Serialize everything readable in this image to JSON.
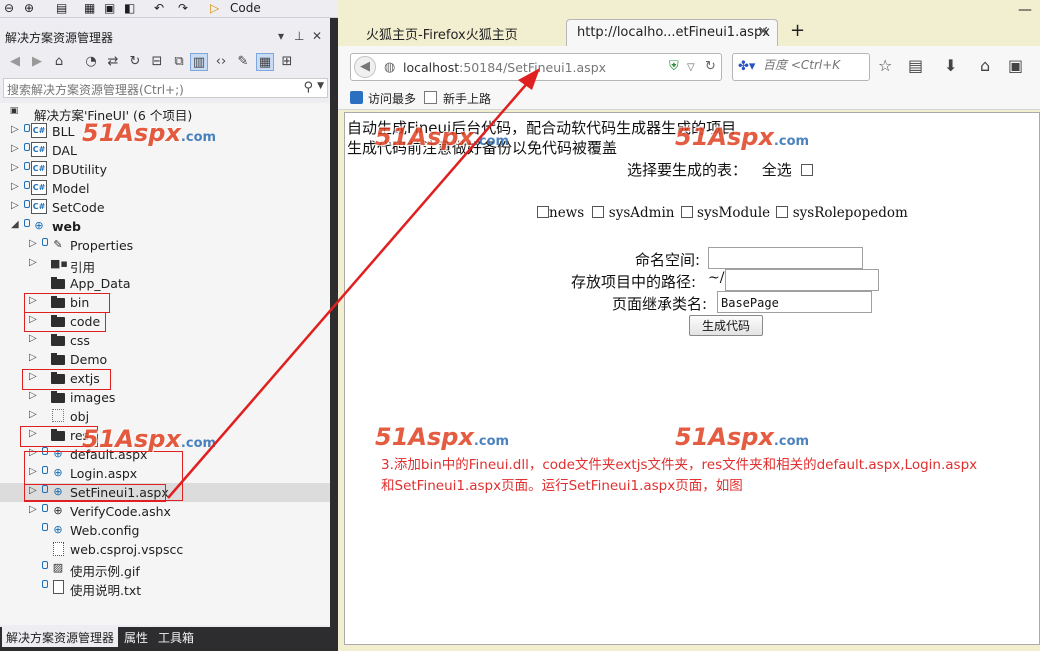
{
  "vs": {
    "top_label": "Code",
    "panel_title": "解决方案资源管理器",
    "panel_controls": [
      "▾",
      "📌",
      "✕"
    ],
    "search_placeholder": "搜索解决方案资源管理器(Ctrl+;)",
    "tree": [
      {
        "label": "解决方案'FineUI' (6 个项目)",
        "level": 0,
        "icon": "solution-icon"
      },
      {
        "label": "BLL",
        "level": 1,
        "icon": "csharp-project-icon"
      },
      {
        "label": "DAL",
        "level": 1,
        "icon": "csharp-project-icon"
      },
      {
        "label": "DBUtility",
        "level": 1,
        "icon": "csharp-project-icon"
      },
      {
        "label": "Model",
        "level": 1,
        "icon": "csharp-project-icon"
      },
      {
        "label": "SetCode",
        "level": 1,
        "icon": "csharp-project-icon"
      },
      {
        "label": "web",
        "level": 1,
        "icon": "web-project-icon",
        "expanded": true
      },
      {
        "label": "Properties",
        "level": 2,
        "icon": "wrench-icon"
      },
      {
        "label": "引用",
        "level": 2,
        "icon": "references-icon"
      },
      {
        "label": "App_Data",
        "level": 2,
        "icon": "folder-icon"
      },
      {
        "label": "bin",
        "level": 2,
        "icon": "folder-icon"
      },
      {
        "label": "code",
        "level": 2,
        "icon": "folder-icon"
      },
      {
        "label": "css",
        "level": 2,
        "icon": "folder-icon"
      },
      {
        "label": "Demo",
        "level": 2,
        "icon": "folder-icon"
      },
      {
        "label": "extjs",
        "level": 2,
        "icon": "folder-icon"
      },
      {
        "label": "images",
        "level": 2,
        "icon": "folder-icon"
      },
      {
        "label": "obj",
        "level": 2,
        "icon": "hidden-folder-icon"
      },
      {
        "label": "res",
        "level": 2,
        "icon": "folder-icon"
      },
      {
        "label": "default.aspx",
        "level": 2,
        "icon": "web-file-icon"
      },
      {
        "label": "Login.aspx",
        "level": 2,
        "icon": "web-file-icon"
      },
      {
        "label": "SetFineui1.aspx",
        "level": 2,
        "icon": "web-file-icon"
      },
      {
        "label": "VerifyCode.ashx",
        "level": 2,
        "icon": "web-handler-icon"
      },
      {
        "label": "Web.config",
        "level": 2,
        "icon": "config-icon"
      },
      {
        "label": "web.csproj.vspscc",
        "level": 2,
        "icon": "file-icon"
      },
      {
        "label": "使用示例.gif",
        "level": 2,
        "icon": "image-file-icon"
      },
      {
        "label": "使用说明.txt",
        "level": 2,
        "icon": "text-file-icon"
      }
    ],
    "bottom_tabs": [
      "解决方案资源管理器",
      "属性",
      "工具箱"
    ]
  },
  "browser": {
    "tabs": [
      {
        "label": "火狐主页-Firefox火狐主页",
        "active": false
      },
      {
        "label": "http://localho...etFineui1.aspx",
        "active": true
      }
    ],
    "new_tab": "+",
    "url_host": "localhost",
    "url_rest": ":50184/SetFineui1.aspx",
    "search_placeholder": "百度 <Ctrl+K",
    "bookmarks": [
      "访问最多",
      "新手上路"
    ]
  },
  "page": {
    "line1": "自动生成Fineui后台代码，配合动软代码生成器生成的项目",
    "line2": "生成代码前注意做好备份以免代码被覆盖",
    "select_label": "选择要生成的表：",
    "select_all": "全选",
    "tables": [
      "news",
      "sysAdmin",
      "sysModule",
      "sysRolepopedom"
    ],
    "namespace_label": "命名空间:",
    "namespace_value": "",
    "path_label": "存放项目中的路径:",
    "path_prefix": "~/",
    "path_value": "",
    "base_label": "页面继承类名:",
    "base_value": "BasePage",
    "generate_button": "生成代码",
    "instruction_line1": "3.添加bin中的Fineui.dll，code文件夹extjs文件夹，res文件夹和相关的default.aspx,Login.aspx",
    "instruction_line2": "和SetFineui1.aspx页面。运行SetFineui1.aspx页面，如图"
  },
  "watermark": {
    "brand": "51Aspx",
    "domain": ".com"
  },
  "colors": {
    "annotation_red": "#e02020",
    "vs_dark": "#2d2d30",
    "firefox_chrome": "#f2eed0",
    "watermark_red": "#e04020",
    "watermark_blue": "#2c6db3"
  }
}
